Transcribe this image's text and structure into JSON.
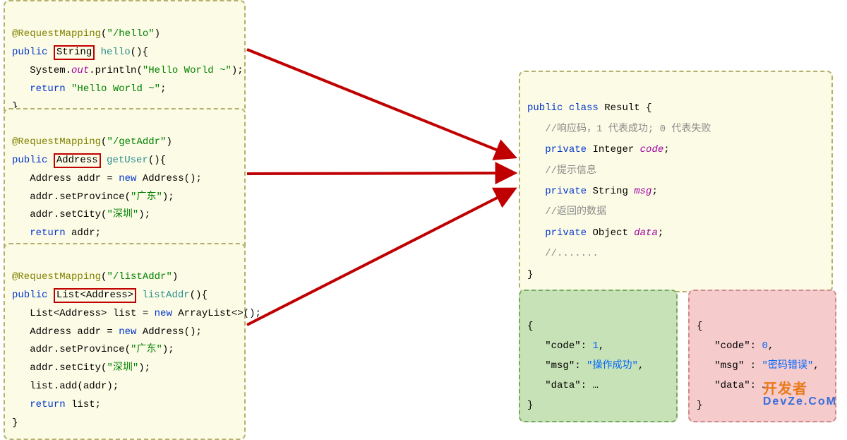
{
  "left": {
    "box1": {
      "annotation_prefix": "@RequestMapping",
      "annotation_arg": "\"/hello\"",
      "modifier": "public",
      "returnType": "String",
      "methodName": "hello",
      "signature_paren": "(){",
      "line_sys": "System.",
      "line_out": "out",
      "line_println_open": ".println(",
      "line_println_str": "\"Hello World ~\"",
      "line_println_close": ");",
      "return_kw": "return ",
      "return_str": "\"Hello World ~\"",
      "return_close": ";",
      "close": "}"
    },
    "box2": {
      "annotation_prefix": "@RequestMapping",
      "annotation_arg": "\"/getAddr\"",
      "modifier": "public",
      "returnType": "Address",
      "methodName": "getUser",
      "signature_paren": "(){",
      "l1a": "Address addr = ",
      "l1new": "new ",
      "l1b": "Address();",
      "l2a": "addr.setProvince(",
      "l2str": "\"广东\"",
      "l2b": ");",
      "l3a": "addr.setCity(",
      "l3str": "\"深圳\"",
      "l3b": ");",
      "return_kw": "return ",
      "return_val": "addr;",
      "close": "}"
    },
    "box3": {
      "annotation_prefix": "@RequestMapping",
      "annotation_arg": "\"/listAddr\"",
      "modifier": "public",
      "returnType": "List<Address>",
      "methodName": "listAddr",
      "signature_paren": "(){",
      "l1a": "List<Address> list = ",
      "l1new": "new ",
      "l1b": "ArrayList<>();",
      "l2a": "Address addr = ",
      "l2new": "new ",
      "l2b": "Address();",
      "l3a": "addr.setProvince(",
      "l3str": "\"广东\"",
      "l3b": ");",
      "l4a": "addr.setCity(",
      "l4str": "\"深圳\"",
      "l4b": ");",
      "l5": "list.add(addr);",
      "return_kw": "return ",
      "return_val": "list;",
      "close": "}"
    }
  },
  "right": {
    "result": {
      "modifier": "public ",
      "class_kw": "class ",
      "className": "Result {",
      "cmt1": "//响应码，1 代表成功; 0 代表失败",
      "f1a": "private ",
      "f1b": "Integer ",
      "f1c": "code",
      "semi": ";",
      "cmt2": "//提示信息",
      "f2a": "private ",
      "f2b": "String ",
      "f2c": "msg",
      "cmt3": "//返回的数据",
      "f3a": "private ",
      "f3b": "Object ",
      "f3c": "data",
      "cmt4": "//.......",
      "close": "}"
    },
    "json_ok": {
      "open": "{",
      "k1": "\"code\"",
      "v1": "1",
      "k2": "\"msg\"",
      "v2": "\"操作成功\"",
      "k3": "\"data\"",
      "v3": "…",
      "close": "}"
    },
    "json_err": {
      "open": "{",
      "k1": "\"code\"",
      "v1": "0",
      "k2": "\"msg\"",
      "v2": "\"密码错误\"",
      "k3": "\"data\"",
      "v3": "…",
      "close": "}"
    }
  },
  "watermark": {
    "line1": "开发者",
    "line2": "DevZe.CoM"
  }
}
